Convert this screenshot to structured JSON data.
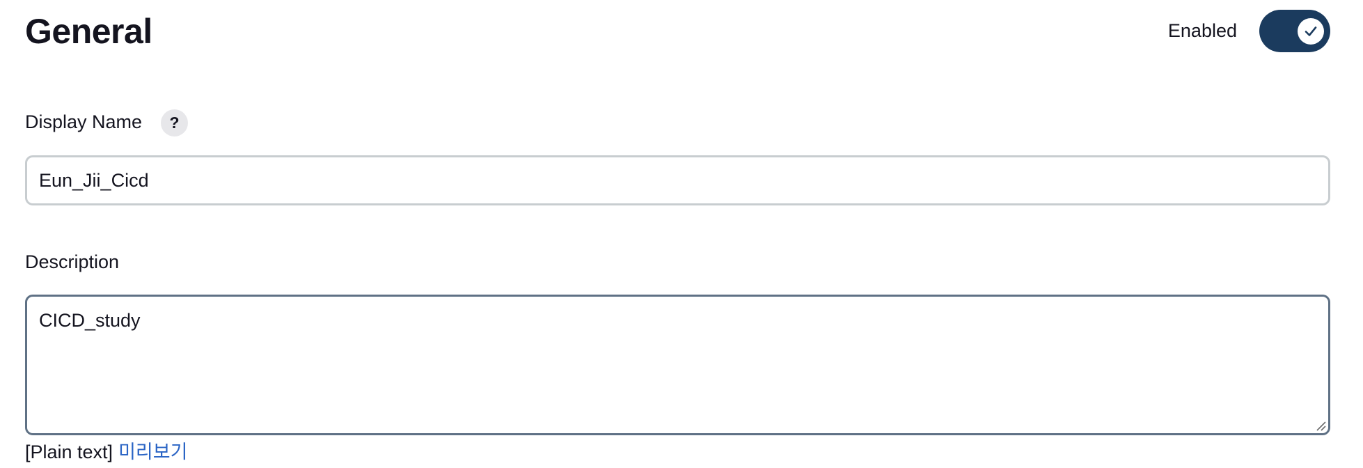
{
  "header": {
    "title": "General",
    "enabled_label": "Enabled",
    "enabled": true
  },
  "display_name": {
    "label": "Display Name",
    "help_label": "?",
    "value": "Eun_Jii_Cicd"
  },
  "description": {
    "label": "Description",
    "value": "CICD_study",
    "format_label": "[Plain text]",
    "preview_link": "미리보기"
  },
  "colors": {
    "toggle_on": "#1b3b5e",
    "link": "#2a64c5",
    "input_border": "#c8cdd0",
    "textarea_border_focused": "#5f7185"
  },
  "icons": {
    "toggle_knob": "checkmark-icon",
    "resize": "resize-grip-icon"
  }
}
